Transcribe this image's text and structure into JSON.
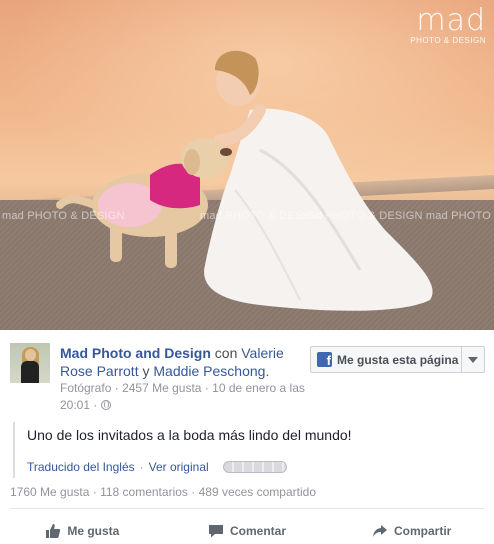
{
  "photo": {
    "logo_main": "mad",
    "logo_sub": "PHOTO & DESIGN",
    "watermarks": [
      "mad PHOTO & DESIGN",
      "mad PHOTO & DESIGN",
      "mad PHOTO & DESIGN mad PHOTO & DESIGN"
    ]
  },
  "post": {
    "author": "Mad Photo and Design",
    "with_word": "con",
    "tagged_1": "Valerie Rose Parrott",
    "and_word": "y",
    "tagged_2": "Maddie Peschong",
    "period": ".",
    "category": "Fotógrafo",
    "likes_page": "2457 Me gusta",
    "date": "10 de enero a las 20:01",
    "separator": "·",
    "like_page_button": "Me gusta esta página",
    "text": "Uno de los invitados a la boda más lindo del mundo!",
    "translated_from": "Traducido del Inglés",
    "see_original": "Ver original"
  },
  "stats": {
    "likes": "1760 Me gusta",
    "comments": "118 comentarios",
    "shares": "489 veces compartido"
  },
  "actions": {
    "like": "Me gusta",
    "comment": "Comentar",
    "share": "Compartir"
  },
  "colors": {
    "link": "#365899",
    "facebook": "#4267b2",
    "meta": "#90949c"
  }
}
